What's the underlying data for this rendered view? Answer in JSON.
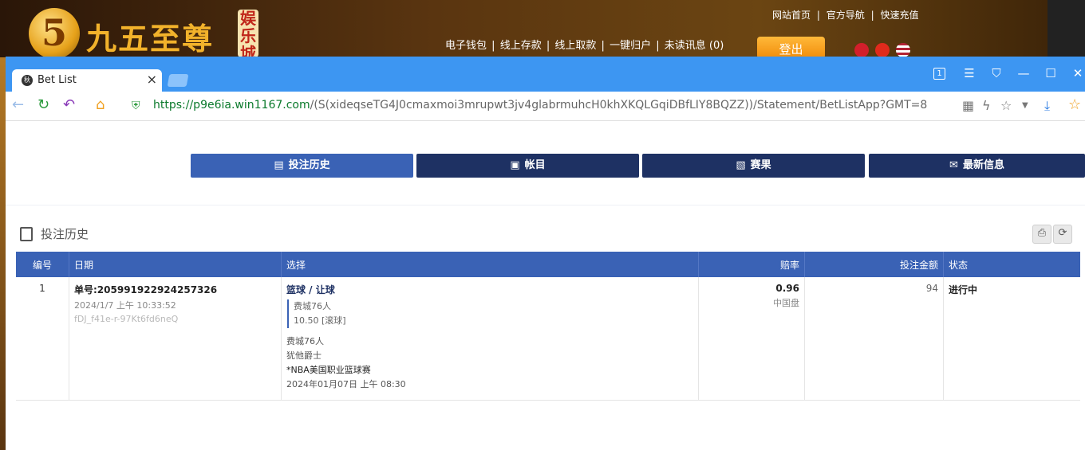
{
  "site": {
    "logo_char": "5",
    "name": "九五至尊",
    "badge": "娱乐城",
    "top_links": [
      "网站首页",
      "|",
      "官方导航",
      "|",
      "快速充值"
    ],
    "nav": [
      "电子钱包",
      "|",
      "线上存款",
      "|",
      "线上取款",
      "|",
      "一键归户",
      "|",
      "未读讯息 (0)"
    ],
    "logout": "登出"
  },
  "browser": {
    "tab_title": "Bet List",
    "tab_favicon": "秋",
    "url_scheme_host": "https://p9e6ia.win1167.com",
    "url_path": "/(S(xideqseTG4J0cmaxmoi3mrupwt3jv4glabrmuhcH0khXKQLGqiDBfLIY8BQZZ))/Statement/BetListApp?GMT=8",
    "window_badge": "1"
  },
  "page": {
    "tabs": [
      {
        "label": "投注历史",
        "icon": "clipboard-icon"
      },
      {
        "label": "帐目",
        "icon": "ledger-icon"
      },
      {
        "label": "赛果",
        "icon": "result-icon"
      },
      {
        "label": "最新信息",
        "icon": "mail-icon"
      }
    ],
    "section_title": "投注历史",
    "columns": [
      "编号",
      "日期",
      "选择",
      "赔率",
      "投注金额",
      "状态"
    ],
    "rows": [
      {
        "no": "1",
        "ticket": "单号:205991922924257326",
        "datetime": "2024/1/7 上午 10:33:52",
        "ref": "fDJ_f41e-r-97Kt6fd6neQ",
        "bet_type": "篮球 / 让球",
        "pick": "费城76人",
        "line": "10.50 [滚球]",
        "home": "费城76人",
        "away": "犹他爵士",
        "league": "*NBA美国职业篮球赛",
        "match_time": "2024年01月07日 上午 08:30",
        "odds": "0.96",
        "odds_type": "中国盘",
        "stake": "94",
        "status": "进行中"
      }
    ]
  }
}
